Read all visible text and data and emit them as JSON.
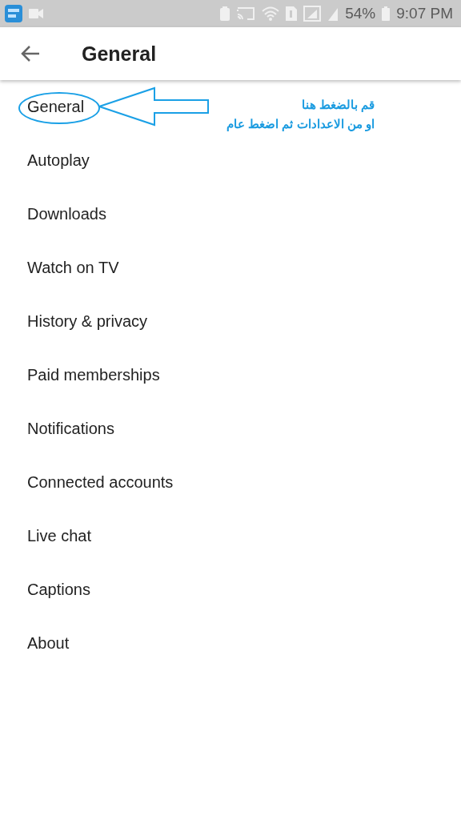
{
  "status_bar": {
    "battery_percent": "54%",
    "time": "9:07 PM"
  },
  "header": {
    "title": "General"
  },
  "items": [
    {
      "label": "General",
      "highlighted": true
    },
    {
      "label": "Autoplay",
      "highlighted": false
    },
    {
      "label": "Downloads",
      "highlighted": false
    },
    {
      "label": "Watch on TV",
      "highlighted": false
    },
    {
      "label": "History & privacy",
      "highlighted": false
    },
    {
      "label": "Paid memberships",
      "highlighted": false
    },
    {
      "label": "Notifications",
      "highlighted": false
    },
    {
      "label": "Connected accounts",
      "highlighted": false
    },
    {
      "label": "Live chat",
      "highlighted": false
    },
    {
      "label": "Captions",
      "highlighted": false
    },
    {
      "label": "About",
      "highlighted": false
    }
  ],
  "annotation": {
    "lines": [
      "قم بالضغط هنا",
      "او من الاعدادات ثم اضغط عام"
    ]
  }
}
